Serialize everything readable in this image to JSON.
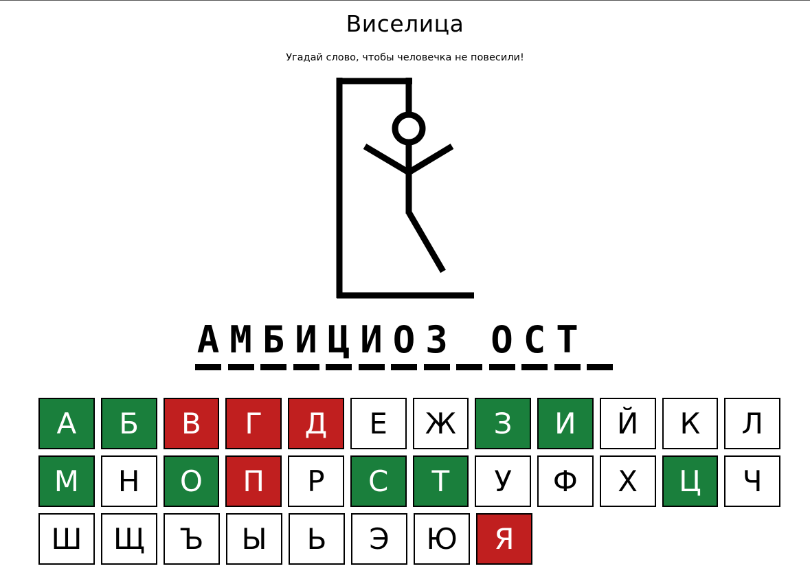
{
  "header": {
    "title": "Виселица",
    "subtitle": "Угадай слово, чтобы человечка не повесили!"
  },
  "game": {
    "word_display": [
      "А",
      "М",
      "Б",
      "И",
      "Ц",
      "И",
      "О",
      "З",
      "",
      "О",
      "С",
      "Т",
      ""
    ],
    "keyboard": [
      {
        "letter": "А",
        "state": "correct"
      },
      {
        "letter": "Б",
        "state": "correct"
      },
      {
        "letter": "В",
        "state": "wrong"
      },
      {
        "letter": "Г",
        "state": "wrong"
      },
      {
        "letter": "Д",
        "state": "wrong"
      },
      {
        "letter": "Е",
        "state": "unused"
      },
      {
        "letter": "Ж",
        "state": "unused"
      },
      {
        "letter": "З",
        "state": "correct"
      },
      {
        "letter": "И",
        "state": "correct"
      },
      {
        "letter": "Й",
        "state": "unused"
      },
      {
        "letter": "К",
        "state": "unused"
      },
      {
        "letter": "Л",
        "state": "unused"
      },
      {
        "letter": "М",
        "state": "correct"
      },
      {
        "letter": "Н",
        "state": "unused"
      },
      {
        "letter": "О",
        "state": "correct"
      },
      {
        "letter": "П",
        "state": "wrong"
      },
      {
        "letter": "Р",
        "state": "unused"
      },
      {
        "letter": "С",
        "state": "correct"
      },
      {
        "letter": "Т",
        "state": "correct"
      },
      {
        "letter": "У",
        "state": "unused"
      },
      {
        "letter": "Ф",
        "state": "unused"
      },
      {
        "letter": "Х",
        "state": "unused"
      },
      {
        "letter": "Ц",
        "state": "correct"
      },
      {
        "letter": "Ч",
        "state": "unused"
      },
      {
        "letter": "Ш",
        "state": "unused"
      },
      {
        "letter": "Щ",
        "state": "unused"
      },
      {
        "letter": "Ъ",
        "state": "unused"
      },
      {
        "letter": "Ы",
        "state": "unused"
      },
      {
        "letter": "Ь",
        "state": "unused"
      },
      {
        "letter": "Э",
        "state": "unused"
      },
      {
        "letter": "Ю",
        "state": "unused"
      },
      {
        "letter": "Я",
        "state": "wrong"
      }
    ],
    "hangman_parts_shown": [
      "gallows",
      "rope",
      "head",
      "body",
      "left-arm",
      "right-arm",
      "right-leg"
    ]
  },
  "colors": {
    "correct": "#1a7f3c",
    "wrong": "#c01f1f",
    "ink": "#000000"
  }
}
